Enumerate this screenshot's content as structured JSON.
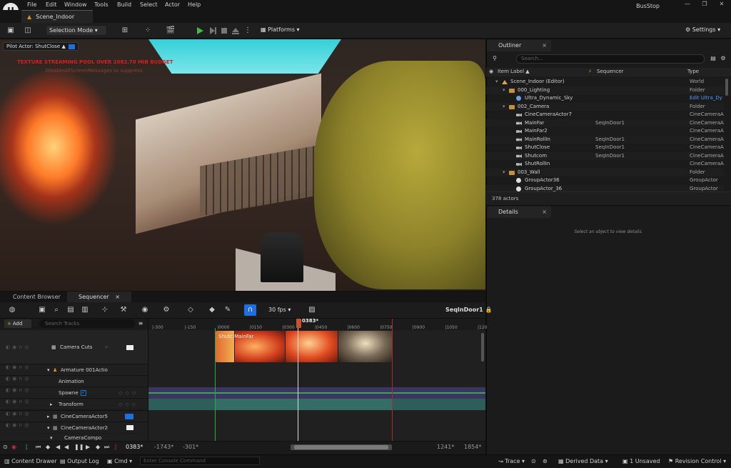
{
  "menu": {
    "items": [
      "File",
      "Edit",
      "Window",
      "Tools",
      "Build",
      "Select",
      "Actor",
      "Help"
    ],
    "project": "BusStop",
    "window_controls": [
      "—",
      "❐",
      "✕"
    ]
  },
  "level_tab": "Scene_Indoor",
  "toolbar": {
    "selection_mode": "Selection Mode",
    "platforms": "Platforms",
    "settings": "Settings"
  },
  "viewport": {
    "pilot_label": "Pilot Actor: ShutClose",
    "warning": "TEXTURE STREAMING POOL OVER 2082.70 MiB BUDGET",
    "warning_sub": "DisableAllScreenMessages to suppress"
  },
  "outliner": {
    "tab": "Outliner",
    "search_placeholder": "Search...",
    "columns": {
      "label": "Item Label ▲",
      "sequencer": "Sequencer",
      "type": "Type"
    },
    "rows": [
      {
        "name": "Scene_Indoor (Editor)",
        "seq": "",
        "type": "World",
        "indent": 0,
        "icon": "world"
      },
      {
        "name": "000_Lighting",
        "seq": "",
        "type": "Folder",
        "indent": 1,
        "icon": "folder"
      },
      {
        "name": "Ultra_Dynamic_Sky",
        "seq": "",
        "type": "Edit Ultra_Dy",
        "indent": 2,
        "icon": "sky",
        "link": true
      },
      {
        "name": "002_Camera",
        "seq": "",
        "type": "Folder",
        "indent": 1,
        "icon": "folder"
      },
      {
        "name": "CineCameraActor7",
        "seq": "",
        "type": "CineCameraA",
        "indent": 2,
        "icon": "cam"
      },
      {
        "name": "MainFar",
        "seq": "SeqInDoor1",
        "type": "CineCameraA",
        "indent": 2,
        "icon": "cam"
      },
      {
        "name": "MainFar2",
        "seq": "",
        "type": "CineCameraA",
        "indent": 2,
        "icon": "cam"
      },
      {
        "name": "MainRollIn",
        "seq": "SeqInDoor1",
        "type": "CineCameraA",
        "indent": 2,
        "icon": "cam"
      },
      {
        "name": "ShutClose",
        "seq": "SeqInDoor1",
        "type": "CineCameraA",
        "indent": 2,
        "icon": "cam"
      },
      {
        "name": "Shutcom",
        "seq": "SeqInDoor1",
        "type": "CineCameraA",
        "indent": 2,
        "icon": "cam"
      },
      {
        "name": "ShutRollIn",
        "seq": "",
        "type": "CineCameraA",
        "indent": 2,
        "icon": "cam"
      },
      {
        "name": "003_Wall",
        "seq": "",
        "type": "Folder",
        "indent": 1,
        "icon": "folder"
      },
      {
        "name": "GroupActor36",
        "seq": "",
        "type": "GroupActor",
        "indent": 2,
        "icon": "group"
      },
      {
        "name": "GroupActor_36",
        "seq": "",
        "type": "GroupActor",
        "indent": 2,
        "icon": "group"
      }
    ],
    "count": "378 actors"
  },
  "details": {
    "tab": "Details",
    "hint": "Select an object to view details."
  },
  "bottom_tabs": {
    "content_browser": "Content Browser",
    "sequencer": "Sequencer"
  },
  "sequencer": {
    "fps": "30 fps",
    "name": "SeqInDoor1",
    "add": "Add",
    "search_placeholder": "Search Tracks",
    "tracks": {
      "camera_cuts": "Camera Cuts",
      "armature": "Armature 001Actio",
      "animation": "Animation",
      "spawned": "Spawne",
      "transform": "Transform",
      "cine5": "CineCameraActor5",
      "cine2": "CineCameraActor2",
      "camcomp": "CameraCompo"
    },
    "ruler_ticks": [
      "-300",
      "-150",
      "0000",
      "0150",
      "0300",
      "0450",
      "0600",
      "0750",
      "0900",
      "1050",
      "120"
    ],
    "current_frame": "0383",
    "shot_label": "Shutc MainFar",
    "transport": {
      "frame": "0383",
      "start": "-1743",
      "in": "-301",
      "out": "1241",
      "end": "1854"
    }
  },
  "statusbar": {
    "content_drawer": "Content Drawer",
    "output_log": "Output Log",
    "cmd": "Cmd",
    "console_placeholder": "Enter Console Command",
    "trace": "Trace",
    "derived_data": "Derived Data",
    "unsaved": "1 Unsaved",
    "revision": "Revision Control"
  }
}
